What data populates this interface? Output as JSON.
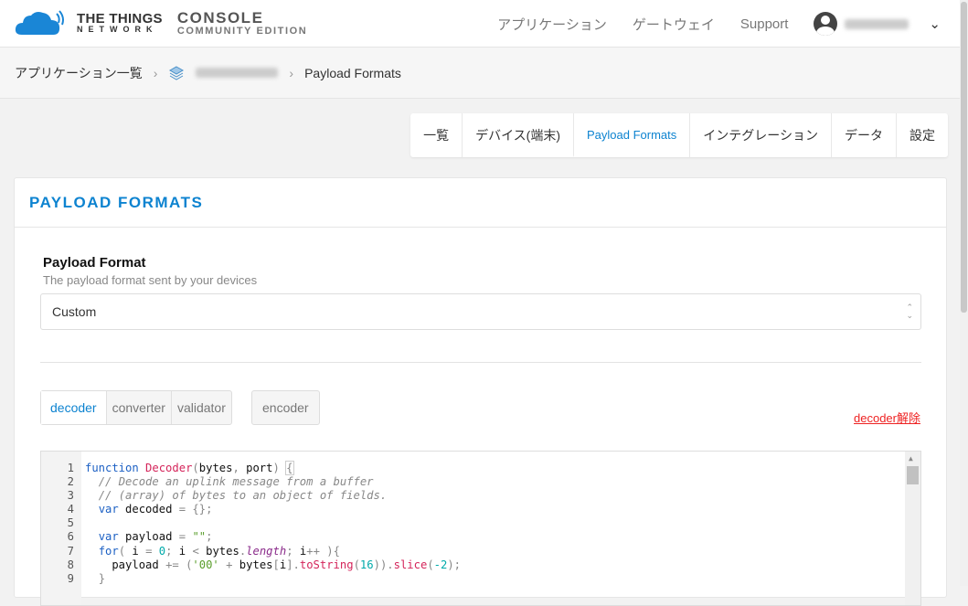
{
  "header": {
    "brand_line1": "THE THINGS",
    "brand_line2": "NETWORK",
    "console": "CONSOLE",
    "edition": "COMMUNITY EDITION",
    "nav": [
      "アプリケーション",
      "ゲートウェイ",
      "Support"
    ]
  },
  "breadcrumb": {
    "root": "アプリケーション一覧",
    "current": "Payload Formats"
  },
  "tabs": [
    "一覧",
    "デバイス(端末)",
    "Payload Formats",
    "インテグレーション",
    "データ",
    "設定"
  ],
  "card": {
    "title": "PAYLOAD FORMATS",
    "format_label": "Payload Format",
    "format_desc": "The payload format sent by your devices",
    "format_value": "Custom",
    "func_tabs": [
      "decoder",
      "converter",
      "validator"
    ],
    "encoder_tab": "encoder",
    "remove_link": "decoder解除"
  },
  "editor": {
    "line_numbers": [
      "1",
      "2",
      "3",
      "4",
      "5",
      "6",
      "7",
      "8",
      "9"
    ]
  },
  "colors": {
    "accent": "#0d83d0",
    "danger": "#ee2222"
  }
}
